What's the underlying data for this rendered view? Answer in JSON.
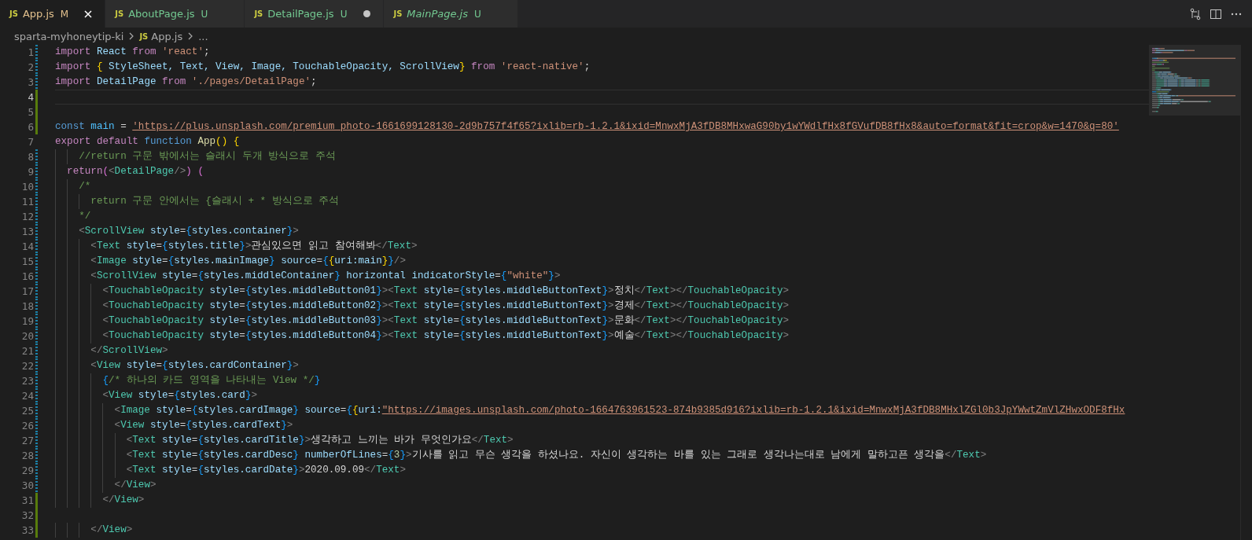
{
  "tabs": [
    {
      "icon": "JS",
      "label": "App.js",
      "status": "M",
      "selected": true,
      "dirty": false,
      "preview": false
    },
    {
      "icon": "JS",
      "label": "AboutPage.js",
      "status": "U",
      "selected": false,
      "dirty": false,
      "preview": false
    },
    {
      "icon": "JS",
      "label": "DetailPage.js",
      "status": "U",
      "selected": false,
      "dirty": true,
      "preview": false
    },
    {
      "icon": "JS",
      "label": "MainPage.js",
      "status": "U",
      "selected": false,
      "dirty": false,
      "preview": true
    }
  ],
  "breadcrumb": {
    "folder": "sparta-myhoneytip-ki",
    "icon": "JS",
    "file": "App.js",
    "more": "..."
  },
  "lines": [
    {
      "number": "1",
      "modified": true,
      "added": false,
      "current": false,
      "tokens": [
        {
          "kind": "kw",
          "text": "import"
        },
        {
          "kind": "var",
          "text": " React "
        },
        {
          "kind": "kw",
          "text": "from"
        },
        {
          "kind": "str",
          "text": " 'react'"
        },
        {
          "kind": "pl",
          "text": ";"
        }
      ]
    },
    {
      "number": "2",
      "modified": true,
      "added": false,
      "current": false,
      "tokens": [
        {
          "kind": "kw",
          "text": "import "
        },
        {
          "kind": "b1",
          "text": "{"
        },
        {
          "kind": "var",
          "text": " StyleSheet, Text, View, Image, TouchableOpacity, ScrollView"
        },
        {
          "kind": "b1",
          "text": "}"
        },
        {
          "kind": "kw",
          "text": " from"
        },
        {
          "kind": "str",
          "text": " 'react-native'"
        },
        {
          "kind": "pl",
          "text": ";"
        }
      ]
    },
    {
      "number": "3",
      "modified": true,
      "added": false,
      "current": false,
      "tokens": [
        {
          "kind": "kw",
          "text": "import"
        },
        {
          "kind": "var",
          "text": " DetailPage "
        },
        {
          "kind": "kw",
          "text": "from"
        },
        {
          "kind": "str",
          "text": " './pages/DetailPage'"
        },
        {
          "kind": "pl",
          "text": ";"
        }
      ]
    },
    {
      "number": "4",
      "modified": false,
      "added": true,
      "current": true
    },
    {
      "number": "5",
      "modified": false,
      "added": true,
      "current": false
    },
    {
      "number": "6",
      "modified": false,
      "added": true,
      "current": false,
      "tokens": [
        {
          "kind": "st",
          "text": "const"
        },
        {
          "kind": "const",
          "text": " main"
        },
        {
          "kind": "pl",
          "text": " = "
        },
        {
          "kind": "url",
          "text": "'https://plus.unsplash.com/premium_photo-1661699128130-2d9b757f4f65?ixlib=rb-1.2.1&ixid=MnwxMjA3fDB8MHxwaG90by1wYWdlfHx8fGVufDB8fHx8&auto=format&fit=crop&w=1470&q=80'"
        }
      ]
    },
    {
      "number": "7",
      "modified": false,
      "added": false,
      "current": false,
      "tokens": [
        {
          "kind": "kw",
          "text": "export default "
        },
        {
          "kind": "st",
          "text": "function"
        },
        {
          "kind": "fn",
          "text": " App"
        },
        {
          "kind": "b1",
          "text": "()"
        },
        {
          "kind": "b1",
          "text": " {"
        }
      ]
    },
    {
      "number": "8",
      "modified": true,
      "added": false,
      "current": false,
      "tokens": [
        {
          "kind": "cm",
          "text": "    //return 구문 밖에서는 슬래시 두개 방식으로 주석"
        }
      ]
    },
    {
      "number": "9",
      "modified": true,
      "added": false,
      "current": false,
      "tokens": [
        {
          "kind": "kw",
          "text": "  return"
        },
        {
          "kind": "b2",
          "text": "("
        },
        {
          "kind": "ang",
          "text": "<"
        },
        {
          "kind": "tag",
          "text": "DetailPage"
        },
        {
          "kind": "ang",
          "text": "/>"
        },
        {
          "kind": "b2",
          "text": ")"
        },
        {
          "kind": "b2",
          "text": " ("
        }
      ]
    },
    {
      "number": "10",
      "modified": true,
      "added": false,
      "current": false,
      "tokens": [
        {
          "kind": "cm",
          "text": "    /*"
        }
      ]
    },
    {
      "number": "11",
      "modified": true,
      "added": false,
      "current": false,
      "tokens": [
        {
          "kind": "cm",
          "text": "      return 구문 안에서는 {슬래시 + * 방식으로 주석"
        }
      ]
    },
    {
      "number": "12",
      "modified": true,
      "added": false,
      "current": false,
      "tokens": [
        {
          "kind": "cm",
          "text": "    */"
        }
      ]
    },
    {
      "number": "13",
      "modified": true,
      "added": false,
      "current": false,
      "tokens": [
        {
          "kind": "ang",
          "text": "    <"
        },
        {
          "kind": "tag",
          "text": "ScrollView"
        },
        {
          "kind": "var",
          "text": " style"
        },
        {
          "kind": "pl",
          "text": "="
        },
        {
          "kind": "b3",
          "text": "{"
        },
        {
          "kind": "var",
          "text": "styles.container"
        },
        {
          "kind": "b3",
          "text": "}"
        },
        {
          "kind": "ang",
          "text": ">"
        }
      ]
    },
    {
      "number": "14",
      "modified": true,
      "added": false,
      "current": false,
      "tokens": [
        {
          "kind": "ang",
          "text": "      <"
        },
        {
          "kind": "tag",
          "text": "Text"
        },
        {
          "kind": "var",
          "text": " style"
        },
        {
          "kind": "pl",
          "text": "="
        },
        {
          "kind": "b3",
          "text": "{"
        },
        {
          "kind": "var",
          "text": "styles.title"
        },
        {
          "kind": "b3",
          "text": "}"
        },
        {
          "kind": "ang",
          "text": ">"
        },
        {
          "kind": "pl",
          "text": "관심있으면 읽고 참여해봐"
        },
        {
          "kind": "ang",
          "text": "</"
        },
        {
          "kind": "tag",
          "text": "Text"
        },
        {
          "kind": "ang",
          "text": ">"
        }
      ]
    },
    {
      "number": "15",
      "modified": true,
      "added": false,
      "current": false,
      "tokens": [
        {
          "kind": "ang",
          "text": "      <"
        },
        {
          "kind": "tag",
          "text": "Image"
        },
        {
          "kind": "var",
          "text": " style"
        },
        {
          "kind": "pl",
          "text": "="
        },
        {
          "kind": "b3",
          "text": "{"
        },
        {
          "kind": "var",
          "text": "styles.mainImage"
        },
        {
          "kind": "b3",
          "text": "}"
        },
        {
          "kind": "var",
          "text": " source"
        },
        {
          "kind": "pl",
          "text": "="
        },
        {
          "kind": "b3",
          "text": "{"
        },
        {
          "kind": "b1",
          "text": "{"
        },
        {
          "kind": "var",
          "text": "uri:main"
        },
        {
          "kind": "b1",
          "text": "}"
        },
        {
          "kind": "b3",
          "text": "}"
        },
        {
          "kind": "ang",
          "text": "/>"
        }
      ]
    },
    {
      "number": "16",
      "modified": true,
      "added": false,
      "current": false,
      "tokens": [
        {
          "kind": "ang",
          "text": "      <"
        },
        {
          "kind": "tag",
          "text": "ScrollView"
        },
        {
          "kind": "var",
          "text": " style"
        },
        {
          "kind": "pl",
          "text": "="
        },
        {
          "kind": "b3",
          "text": "{"
        },
        {
          "kind": "var",
          "text": "styles.middleContainer"
        },
        {
          "kind": "b3",
          "text": "}"
        },
        {
          "kind": "var",
          "text": " horizontal indicatorStyle"
        },
        {
          "kind": "pl",
          "text": "="
        },
        {
          "kind": "b3",
          "text": "{"
        },
        {
          "kind": "str",
          "text": "\"white\""
        },
        {
          "kind": "b3",
          "text": "}"
        },
        {
          "kind": "ang",
          "text": ">"
        }
      ]
    },
    {
      "number": "17",
      "modified": true,
      "added": false,
      "current": false,
      "tokens": [
        {
          "kind": "ang",
          "text": "        <"
        },
        {
          "kind": "tag",
          "text": "TouchableOpacity"
        },
        {
          "kind": "var",
          "text": " style"
        },
        {
          "kind": "pl",
          "text": "="
        },
        {
          "kind": "b3",
          "text": "{"
        },
        {
          "kind": "var",
          "text": "styles.middleButton01"
        },
        {
          "kind": "b3",
          "text": "}"
        },
        {
          "kind": "ang",
          "text": "><"
        },
        {
          "kind": "tag",
          "text": "Text"
        },
        {
          "kind": "var",
          "text": " style"
        },
        {
          "kind": "pl",
          "text": "="
        },
        {
          "kind": "b3",
          "text": "{"
        },
        {
          "kind": "var",
          "text": "styles.middleButtonText"
        },
        {
          "kind": "b3",
          "text": "}"
        },
        {
          "kind": "ang",
          "text": ">"
        },
        {
          "kind": "pl",
          "text": "정치"
        },
        {
          "kind": "ang",
          "text": "</"
        },
        {
          "kind": "tag",
          "text": "Text"
        },
        {
          "kind": "ang",
          "text": "></"
        },
        {
          "kind": "tag",
          "text": "TouchableOpacity"
        },
        {
          "kind": "ang",
          "text": ">"
        }
      ]
    },
    {
      "number": "18",
      "modified": true,
      "added": false,
      "current": false,
      "tokens": [
        {
          "kind": "ang",
          "text": "        <"
        },
        {
          "kind": "tag",
          "text": "TouchableOpacity"
        },
        {
          "kind": "var",
          "text": " style"
        },
        {
          "kind": "pl",
          "text": "="
        },
        {
          "kind": "b3",
          "text": "{"
        },
        {
          "kind": "var",
          "text": "styles.middleButton02"
        },
        {
          "kind": "b3",
          "text": "}"
        },
        {
          "kind": "ang",
          "text": "><"
        },
        {
          "kind": "tag",
          "text": "Text"
        },
        {
          "kind": "var",
          "text": " style"
        },
        {
          "kind": "pl",
          "text": "="
        },
        {
          "kind": "b3",
          "text": "{"
        },
        {
          "kind": "var",
          "text": "styles.middleButtonText"
        },
        {
          "kind": "b3",
          "text": "}"
        },
        {
          "kind": "ang",
          "text": ">"
        },
        {
          "kind": "pl",
          "text": "경제"
        },
        {
          "kind": "ang",
          "text": "</"
        },
        {
          "kind": "tag",
          "text": "Text"
        },
        {
          "kind": "ang",
          "text": "></"
        },
        {
          "kind": "tag",
          "text": "TouchableOpacity"
        },
        {
          "kind": "ang",
          "text": ">"
        }
      ]
    },
    {
      "number": "19",
      "modified": true,
      "added": false,
      "current": false,
      "tokens": [
        {
          "kind": "ang",
          "text": "        <"
        },
        {
          "kind": "tag",
          "text": "TouchableOpacity"
        },
        {
          "kind": "var",
          "text": " style"
        },
        {
          "kind": "pl",
          "text": "="
        },
        {
          "kind": "b3",
          "text": "{"
        },
        {
          "kind": "var",
          "text": "styles.middleButton03"
        },
        {
          "kind": "b3",
          "text": "}"
        },
        {
          "kind": "ang",
          "text": "><"
        },
        {
          "kind": "tag",
          "text": "Text"
        },
        {
          "kind": "var",
          "text": " style"
        },
        {
          "kind": "pl",
          "text": "="
        },
        {
          "kind": "b3",
          "text": "{"
        },
        {
          "kind": "var",
          "text": "styles.middleButtonText"
        },
        {
          "kind": "b3",
          "text": "}"
        },
        {
          "kind": "ang",
          "text": ">"
        },
        {
          "kind": "pl",
          "text": "문화"
        },
        {
          "kind": "ang",
          "text": "</"
        },
        {
          "kind": "tag",
          "text": "Text"
        },
        {
          "kind": "ang",
          "text": "></"
        },
        {
          "kind": "tag",
          "text": "TouchableOpacity"
        },
        {
          "kind": "ang",
          "text": ">"
        }
      ]
    },
    {
      "number": "20",
      "modified": true,
      "added": false,
      "current": false,
      "tokens": [
        {
          "kind": "ang",
          "text": "        <"
        },
        {
          "kind": "tag",
          "text": "TouchableOpacity"
        },
        {
          "kind": "var",
          "text": " style"
        },
        {
          "kind": "pl",
          "text": "="
        },
        {
          "kind": "b3",
          "text": "{"
        },
        {
          "kind": "var",
          "text": "styles.middleButton04"
        },
        {
          "kind": "b3",
          "text": "}"
        },
        {
          "kind": "ang",
          "text": "><"
        },
        {
          "kind": "tag",
          "text": "Text"
        },
        {
          "kind": "var",
          "text": " style"
        },
        {
          "kind": "pl",
          "text": "="
        },
        {
          "kind": "b3",
          "text": "{"
        },
        {
          "kind": "var",
          "text": "styles.middleButtonText"
        },
        {
          "kind": "b3",
          "text": "}"
        },
        {
          "kind": "ang",
          "text": ">"
        },
        {
          "kind": "pl",
          "text": "예술"
        },
        {
          "kind": "ang",
          "text": "</"
        },
        {
          "kind": "tag",
          "text": "Text"
        },
        {
          "kind": "ang",
          "text": "></"
        },
        {
          "kind": "tag",
          "text": "TouchableOpacity"
        },
        {
          "kind": "ang",
          "text": ">"
        }
      ]
    },
    {
      "number": "21",
      "modified": true,
      "added": false,
      "current": false,
      "tokens": [
        {
          "kind": "ang",
          "text": "      </"
        },
        {
          "kind": "tag",
          "text": "ScrollView"
        },
        {
          "kind": "ang",
          "text": ">"
        }
      ]
    },
    {
      "number": "22",
      "modified": true,
      "added": false,
      "current": false,
      "tokens": [
        {
          "kind": "ang",
          "text": "      <"
        },
        {
          "kind": "tag",
          "text": "View"
        },
        {
          "kind": "var",
          "text": " style"
        },
        {
          "kind": "pl",
          "text": "="
        },
        {
          "kind": "b3",
          "text": "{"
        },
        {
          "kind": "var",
          "text": "styles.cardContainer"
        },
        {
          "kind": "b3",
          "text": "}"
        },
        {
          "kind": "ang",
          "text": ">"
        }
      ]
    },
    {
      "number": "23",
      "modified": true,
      "added": false,
      "current": false,
      "tokens": [
        {
          "kind": "b3",
          "text": "        {"
        },
        {
          "kind": "cm",
          "text": "/* 하나의 카드 영역을 나타내는 View */"
        },
        {
          "kind": "b3",
          "text": "}"
        }
      ]
    },
    {
      "number": "24",
      "modified": true,
      "added": false,
      "current": false,
      "tokens": [
        {
          "kind": "ang",
          "text": "        <"
        },
        {
          "kind": "tag",
          "text": "View"
        },
        {
          "kind": "var",
          "text": " style"
        },
        {
          "kind": "pl",
          "text": "="
        },
        {
          "kind": "b3",
          "text": "{"
        },
        {
          "kind": "var",
          "text": "styles.card"
        },
        {
          "kind": "b3",
          "text": "}"
        },
        {
          "kind": "ang",
          "text": ">"
        }
      ]
    },
    {
      "number": "25",
      "modified": true,
      "added": false,
      "current": false,
      "tokens": [
        {
          "kind": "ang",
          "text": "          <"
        },
        {
          "kind": "tag",
          "text": "Image"
        },
        {
          "kind": "var",
          "text": " style"
        },
        {
          "kind": "pl",
          "text": "="
        },
        {
          "kind": "b3",
          "text": "{"
        },
        {
          "kind": "var",
          "text": "styles.cardImage"
        },
        {
          "kind": "b3",
          "text": "}"
        },
        {
          "kind": "var",
          "text": " source"
        },
        {
          "kind": "pl",
          "text": "="
        },
        {
          "kind": "b3",
          "text": "{"
        },
        {
          "kind": "b1",
          "text": "{"
        },
        {
          "kind": "var",
          "text": "uri:"
        },
        {
          "kind": "url",
          "text": "\"https://images.unsplash.com/photo-1664763961523-874b9385d916?ixlib=rb-1.2.1&ixid=MnwxMjA3fDB8MHxlZGl0b3JpYWwtZmVlZHwxODF8fHx"
        }
      ]
    },
    {
      "number": "26",
      "modified": true,
      "added": false,
      "current": false,
      "tokens": [
        {
          "kind": "ang",
          "text": "          <"
        },
        {
          "kind": "tag",
          "text": "View"
        },
        {
          "kind": "var",
          "text": " style"
        },
        {
          "kind": "pl",
          "text": "="
        },
        {
          "kind": "b3",
          "text": "{"
        },
        {
          "kind": "var",
          "text": "styles.cardText"
        },
        {
          "kind": "b3",
          "text": "}"
        },
        {
          "kind": "ang",
          "text": ">"
        }
      ]
    },
    {
      "number": "27",
      "modified": true,
      "added": false,
      "current": false,
      "tokens": [
        {
          "kind": "ang",
          "text": "            <"
        },
        {
          "kind": "tag",
          "text": "Text"
        },
        {
          "kind": "var",
          "text": " style"
        },
        {
          "kind": "pl",
          "text": "="
        },
        {
          "kind": "b3",
          "text": "{"
        },
        {
          "kind": "var",
          "text": "styles.cardTitle"
        },
        {
          "kind": "b3",
          "text": "}"
        },
        {
          "kind": "ang",
          "text": ">"
        },
        {
          "kind": "pl",
          "text": "생각하고 느끼는 바가 무엇인가요"
        },
        {
          "kind": "ang",
          "text": "</"
        },
        {
          "kind": "tag",
          "text": "Text"
        },
        {
          "kind": "ang",
          "text": ">"
        }
      ]
    },
    {
      "number": "28",
      "modified": true,
      "added": false,
      "current": false,
      "tokens": [
        {
          "kind": "ang",
          "text": "            <"
        },
        {
          "kind": "tag",
          "text": "Text"
        },
        {
          "kind": "var",
          "text": " style"
        },
        {
          "kind": "pl",
          "text": "="
        },
        {
          "kind": "b3",
          "text": "{"
        },
        {
          "kind": "var",
          "text": "styles.cardDesc"
        },
        {
          "kind": "b3",
          "text": "}"
        },
        {
          "kind": "var",
          "text": " numberOfLines"
        },
        {
          "kind": "pl",
          "text": "="
        },
        {
          "kind": "b3",
          "text": "{"
        },
        {
          "kind": "num",
          "text": "3"
        },
        {
          "kind": "b3",
          "text": "}"
        },
        {
          "kind": "ang",
          "text": ">"
        },
        {
          "kind": "pl",
          "text": "기사를 읽고 무슨 생각을 하셨나요. 자신이 생각하는 바를 있는 그래로 생각나는대로 남에게 말하고픈 생각을"
        },
        {
          "kind": "ang",
          "text": "</"
        },
        {
          "kind": "tag",
          "text": "Text"
        },
        {
          "kind": "ang",
          "text": ">"
        }
      ]
    },
    {
      "number": "29",
      "modified": true,
      "added": false,
      "current": false,
      "tokens": [
        {
          "kind": "ang",
          "text": "            <"
        },
        {
          "kind": "tag",
          "text": "Text"
        },
        {
          "kind": "var",
          "text": " style"
        },
        {
          "kind": "pl",
          "text": "="
        },
        {
          "kind": "b3",
          "text": "{"
        },
        {
          "kind": "var",
          "text": "styles.cardDate"
        },
        {
          "kind": "b3",
          "text": "}"
        },
        {
          "kind": "ang",
          "text": ">"
        },
        {
          "kind": "pl",
          "text": "2020.09.09"
        },
        {
          "kind": "ang",
          "text": "</"
        },
        {
          "kind": "tag",
          "text": "Text"
        },
        {
          "kind": "ang",
          "text": ">"
        }
      ]
    },
    {
      "number": "30",
      "modified": true,
      "added": false,
      "current": false,
      "tokens": [
        {
          "kind": "ang",
          "text": "          </"
        },
        {
          "kind": "tag",
          "text": "View"
        },
        {
          "kind": "ang",
          "text": ">"
        }
      ]
    },
    {
      "number": "31",
      "modified": false,
      "added": true,
      "current": false,
      "tokens": [
        {
          "kind": "ang",
          "text": "        </"
        },
        {
          "kind": "tag",
          "text": "View"
        },
        {
          "kind": "ang",
          "text": ">"
        }
      ]
    },
    {
      "number": "32",
      "modified": false,
      "added": true,
      "current": false
    },
    {
      "number": "33",
      "modified": false,
      "added": true,
      "current": false,
      "tokens": [
        {
          "kind": "ang",
          "text": "      </"
        },
        {
          "kind": "tag",
          "text": "View"
        },
        {
          "kind": "ang",
          "text": ">"
        }
      ]
    }
  ]
}
